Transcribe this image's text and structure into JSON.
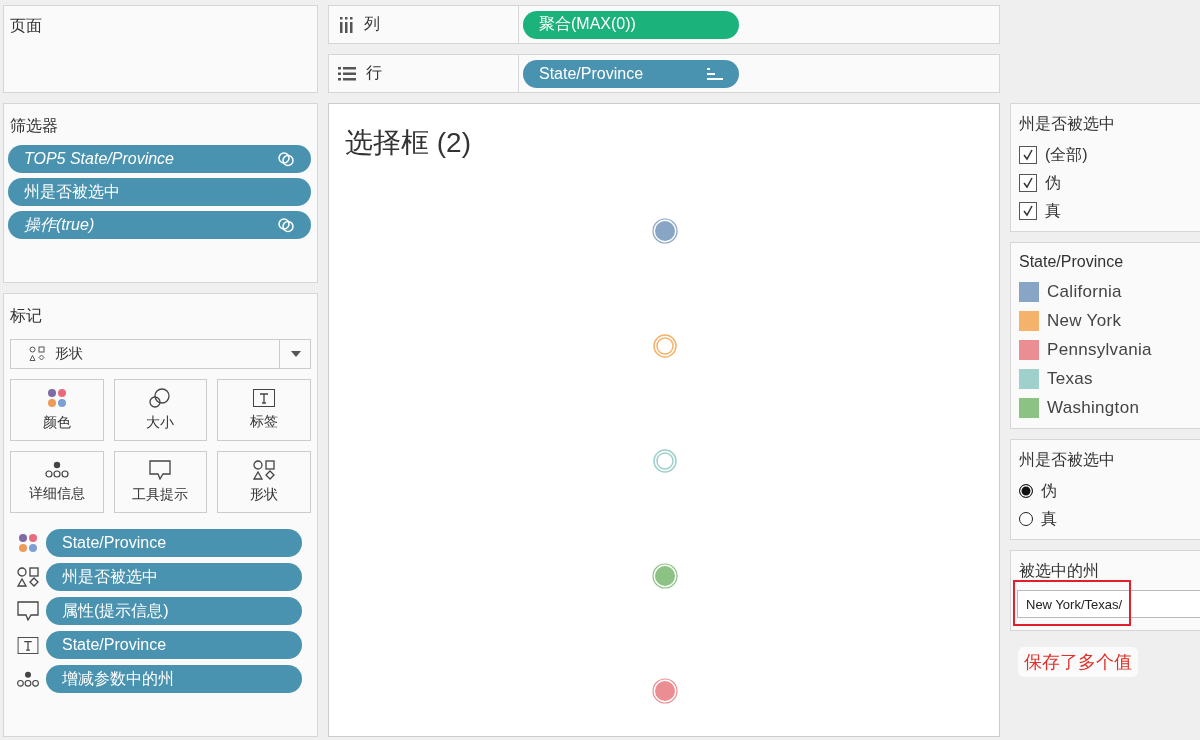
{
  "pages_panel": {
    "title": "页面"
  },
  "shelves": [
    {
      "kind": "columns",
      "label": "列",
      "pill": {
        "text": "聚合(MAX(0))",
        "kind": "measure",
        "sorted": false
      }
    },
    {
      "kind": "rows",
      "label": "行",
      "pill": {
        "text": "State/Province",
        "kind": "dimension",
        "sorted": true
      }
    }
  ],
  "filters": {
    "title": "筛选器",
    "items": [
      {
        "text": "TOP5 State/Province",
        "context": true,
        "linked": true
      },
      {
        "text": "州是否被选中",
        "context": false,
        "linked": false
      },
      {
        "text": "操作(true)",
        "context": true,
        "linked": true
      }
    ]
  },
  "marks_card": {
    "title": "标记",
    "mark_type": "形状",
    "buttons": [
      {
        "kind": "color",
        "label": "颜色"
      },
      {
        "kind": "size",
        "label": "大小"
      },
      {
        "kind": "label",
        "label": "标签"
      },
      {
        "kind": "detail",
        "label": "详细信息"
      },
      {
        "kind": "tooltip",
        "label": "工具提示"
      },
      {
        "kind": "shape",
        "label": "形状"
      }
    ],
    "fields": [
      {
        "kind": "color",
        "text": "State/Province"
      },
      {
        "kind": "shape",
        "text": "州是否被选中"
      },
      {
        "kind": "tooltip",
        "text": "属性(提示信息)"
      },
      {
        "kind": "label",
        "text": "State/Province"
      },
      {
        "kind": "detail",
        "text": "增减参数中的州"
      }
    ]
  },
  "view": {
    "title": "选择框 (2)",
    "marks": [
      {
        "color": "#88a5c6",
        "filled": true
      },
      {
        "color": "#f5b26b",
        "filled": false
      },
      {
        "color": "#9fd0cb",
        "filled": false
      },
      {
        "color": "#8cc283",
        "filled": true
      },
      {
        "color": "#ea8e94",
        "filled": true
      }
    ]
  },
  "legends": [
    {
      "kind": "checklist",
      "title": "州是否被选中",
      "items": [
        {
          "label": "(全部)",
          "checked": true
        },
        {
          "label": "伪",
          "checked": true
        },
        {
          "label": "真",
          "checked": true
        }
      ]
    },
    {
      "kind": "colors",
      "title": "State/Province",
      "items": [
        {
          "label": "California",
          "color": "#88a5c6"
        },
        {
          "label": "New York",
          "color": "#f5b26b"
        },
        {
          "label": "Pennsylvania",
          "color": "#ea8e94"
        },
        {
          "label": "Texas",
          "color": "#9fd0cb"
        },
        {
          "label": "Washington",
          "color": "#8cc283"
        }
      ]
    },
    {
      "kind": "radio",
      "title": "州是否被选中",
      "items": [
        {
          "label": "伪",
          "selected": true
        },
        {
          "label": "真",
          "selected": false
        }
      ]
    },
    {
      "kind": "input",
      "title": "被选中的州",
      "value": "New York/Texas/",
      "highlighted": true
    }
  ],
  "annotation": {
    "text": "保存了多个值"
  }
}
